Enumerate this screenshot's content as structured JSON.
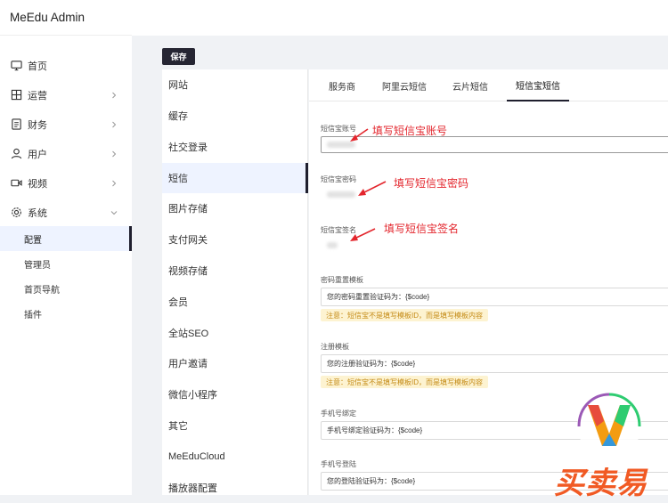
{
  "app": {
    "title": "MeEdu Admin"
  },
  "sidebar": {
    "items": [
      {
        "label": "首页",
        "icon": "monitor-icon",
        "has_children": false
      },
      {
        "label": "运营",
        "icon": "grid-icon",
        "has_children": true
      },
      {
        "label": "财务",
        "icon": "document-icon",
        "has_children": true
      },
      {
        "label": "用户",
        "icon": "user-icon",
        "has_children": true
      },
      {
        "label": "视频",
        "icon": "video-icon",
        "has_children": true
      },
      {
        "label": "系统",
        "icon": "gear-icon",
        "has_children": true,
        "expanded": true
      }
    ],
    "sub_items": [
      {
        "label": "配置",
        "active": true
      },
      {
        "label": "管理员",
        "active": false
      },
      {
        "label": "首页导航",
        "active": false
      },
      {
        "label": "插件",
        "active": false
      }
    ]
  },
  "toolbar": {
    "save_label": "保存"
  },
  "config_menu": {
    "items": [
      "网站",
      "缓存",
      "社交登录",
      "短信",
      "图片存储",
      "支付网关",
      "视频存储",
      "会员",
      "全站SEO",
      "用户邀请",
      "微信小程序",
      "其它",
      "MeEduCloud",
      "播放器配置"
    ],
    "active_index": 3
  },
  "tabs": {
    "items": [
      "服务商",
      "阿里云短信",
      "云片短信",
      "短信宝短信"
    ],
    "active_index": 3
  },
  "form": {
    "account": {
      "label": "短信宝账号",
      "annotation": "填写短信宝账号"
    },
    "password": {
      "label": "短信宝密码",
      "annotation": "填写短信宝密码"
    },
    "signature": {
      "label": "短信宝签名",
      "annotation": "填写短信宝签名"
    },
    "templates": [
      {
        "label": "密码重置模板",
        "value": "您的密码重置验证码为：{$code}",
        "tip": "注意：短信宝不是填写模板ID，而是填写模板内容"
      },
      {
        "label": "注册模板",
        "value": "您的注册验证码为：{$code}",
        "tip": "注意：短信宝不是填写模板ID，而是填写模板内容"
      },
      {
        "label": "手机号绑定",
        "value": "手机号绑定验证码为：{$code}"
      },
      {
        "label": "手机号登陆",
        "value": "您的登陆验证码为：{$code}"
      }
    ]
  },
  "watermark": {
    "text": "买卖易",
    "colors": [
      "#e74c3c",
      "#f39c12",
      "#2ecc71",
      "#3498db",
      "#9b59b6"
    ]
  },
  "colors": {
    "accent": "#262633",
    "annotation": "#e3262d",
    "tip_bg": "#fdf3d1",
    "tip_text": "#c48a14"
  }
}
